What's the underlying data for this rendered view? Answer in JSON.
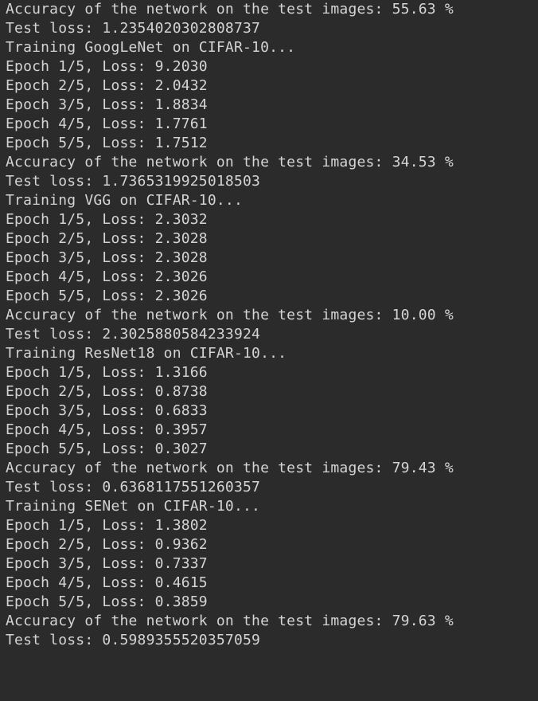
{
  "console": {
    "lines": [
      "Accuracy of the network on the test images: 55.63 %",
      "Test loss: 1.2354020302808737",
      "Training GoogLeNet on CIFAR-10...",
      "Epoch 1/5, Loss: 9.2030",
      "Epoch 2/5, Loss: 2.0432",
      "Epoch 3/5, Loss: 1.8834",
      "Epoch 4/5, Loss: 1.7761",
      "Epoch 5/5, Loss: 1.7512",
      "Accuracy of the network on the test images: 34.53 %",
      "Test loss: 1.7365319925018503",
      "Training VGG on CIFAR-10...",
      "Epoch 1/5, Loss: 2.3032",
      "Epoch 2/5, Loss: 2.3028",
      "Epoch 3/5, Loss: 2.3028",
      "Epoch 4/5, Loss: 2.3026",
      "Epoch 5/5, Loss: 2.3026",
      "Accuracy of the network on the test images: 10.00 %",
      "Test loss: 2.3025880584233924",
      "Training ResNet18 on CIFAR-10...",
      "Epoch 1/5, Loss: 1.3166",
      "Epoch 2/5, Loss: 0.8738",
      "Epoch 3/5, Loss: 0.6833",
      "Epoch 4/5, Loss: 0.3957",
      "Epoch 5/5, Loss: 0.3027",
      "Accuracy of the network on the test images: 79.43 %",
      "Test loss: 0.6368117551260357",
      "Training SENet on CIFAR-10...",
      "Epoch 1/5, Loss: 1.3802",
      "Epoch 2/5, Loss: 0.9362",
      "Epoch 3/5, Loss: 0.7337",
      "Epoch 4/5, Loss: 0.4615",
      "Epoch 5/5, Loss: 0.3859",
      "Accuracy of the network on the test images: 79.63 %",
      "Test loss: 0.5989355520357059"
    ]
  },
  "colors": {
    "background": "#2b2b2b",
    "text": "#d4d4d4"
  }
}
